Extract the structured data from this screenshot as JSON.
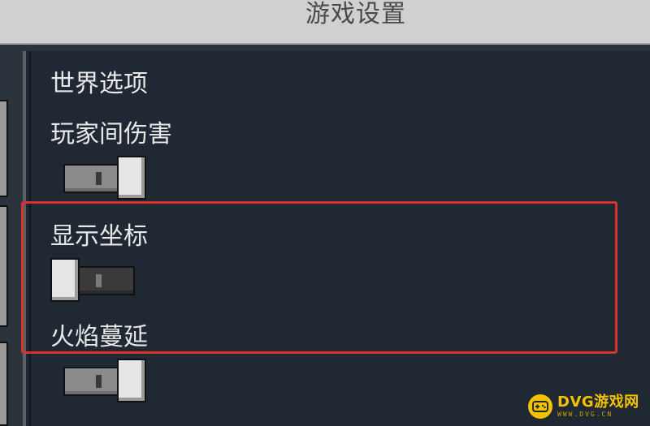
{
  "window": {
    "title": "游戏设置"
  },
  "section": {
    "heading": "世界选项"
  },
  "settings": [
    {
      "label": "玩家间伤害",
      "state": "on"
    },
    {
      "label": "显示坐标",
      "state": "off"
    },
    {
      "label": "火焰蔓延",
      "state": "on"
    }
  ],
  "highlight": {
    "color": "#d8332b"
  },
  "watermark": {
    "brand": "DVG游戏网",
    "url": "WWW.DVG.CN",
    "icon": "gamepad-icon",
    "color": "#f2c200"
  }
}
